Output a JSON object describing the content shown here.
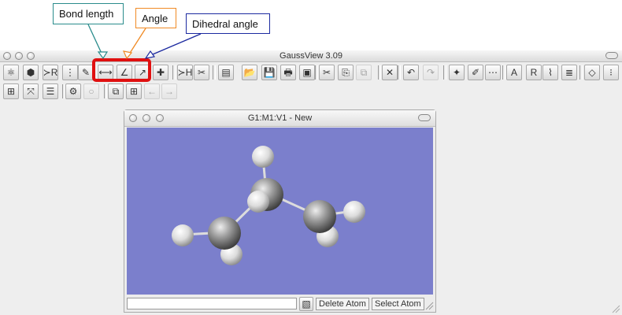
{
  "annotations": {
    "bond_length": "Bond length",
    "angle": "Angle",
    "dihedral_angle": "Dihedral angle",
    "colors": {
      "bond_length": "#2a8c8c",
      "angle": "#f08a24",
      "dihedral_angle": "#1c2aa0",
      "highlight": "#e01010"
    }
  },
  "main_window": {
    "title": "GaussView 3.09",
    "toolbar_row1": [
      {
        "icon": "element-icon",
        "glyph": "⚛"
      },
      {
        "icon": "ring-icon",
        "glyph": "⬢"
      },
      {
        "icon": "r-group-icon",
        "glyph": "≻R"
      },
      {
        "icon": "biofragment-icon",
        "glyph": "⋮"
      },
      {
        "icon": "custom-fragment-icon",
        "glyph": "✎"
      },
      {
        "icon": "bond-length-icon",
        "glyph": "⟷"
      },
      {
        "icon": "angle-icon",
        "glyph": "∠"
      },
      {
        "icon": "dihedral-icon",
        "glyph": "↗"
      },
      {
        "icon": "inquire-icon",
        "glyph": "✚"
      },
      {
        "icon": "add-valence-icon",
        "glyph": "≻H"
      },
      {
        "icon": "delete-atom-icon",
        "glyph": "✂"
      },
      {
        "icon": "new-window-icon",
        "glyph": "▤"
      },
      {
        "icon": "open-folder-icon",
        "glyph": "📂"
      },
      {
        "icon": "save-icon",
        "glyph": "💾"
      },
      {
        "icon": "print-icon",
        "glyph": "🖶"
      },
      {
        "icon": "image-icon",
        "glyph": "▣"
      },
      {
        "icon": "cut-icon",
        "glyph": "✂"
      },
      {
        "icon": "copy-icon",
        "glyph": "⎘"
      },
      {
        "icon": "paste-icon",
        "glyph": "⧉"
      },
      {
        "icon": "delete-icon",
        "glyph": "✕"
      },
      {
        "icon": "undo-icon",
        "glyph": "↶"
      },
      {
        "icon": "redo-icon",
        "glyph": "↷"
      },
      {
        "icon": "symmetry-icon",
        "glyph": "✦"
      },
      {
        "icon": "clean-icon",
        "glyph": "✐"
      },
      {
        "icon": "fragment-palette-icon",
        "glyph": "⋯"
      },
      {
        "icon": "atom-labels-icon",
        "glyph": "A"
      },
      {
        "icon": "r-label-icon",
        "glyph": "R"
      },
      {
        "icon": "bonds-icon",
        "glyph": "⌇"
      },
      {
        "icon": "layers-icon",
        "glyph": "≣"
      },
      {
        "icon": "diamond-icon",
        "glyph": "◇"
      },
      {
        "icon": "dipole-icon",
        "glyph": "⁝"
      }
    ],
    "toolbar_row2": [
      {
        "icon": "add-fragment-icon",
        "glyph": "⊞"
      },
      {
        "icon": "expand-icon",
        "glyph": "⤧"
      },
      {
        "icon": "list-icon",
        "glyph": "☰"
      },
      {
        "icon": "gaussian-icon",
        "glyph": "⚙"
      },
      {
        "icon": "disabled-icon",
        "glyph": "○"
      },
      {
        "icon": "cascade-windows-icon",
        "glyph": "⧉"
      },
      {
        "icon": "tile-windows-icon",
        "glyph": "⊞"
      },
      {
        "icon": "back-icon",
        "glyph": "←"
      },
      {
        "icon": "forward-icon",
        "glyph": "→"
      }
    ]
  },
  "molecule_window": {
    "title": "G1:M1:V1 - New",
    "background_color": "#7b7fcc",
    "status": {
      "delete_atom": "Delete Atom",
      "select_atom": "Select Atom"
    }
  }
}
